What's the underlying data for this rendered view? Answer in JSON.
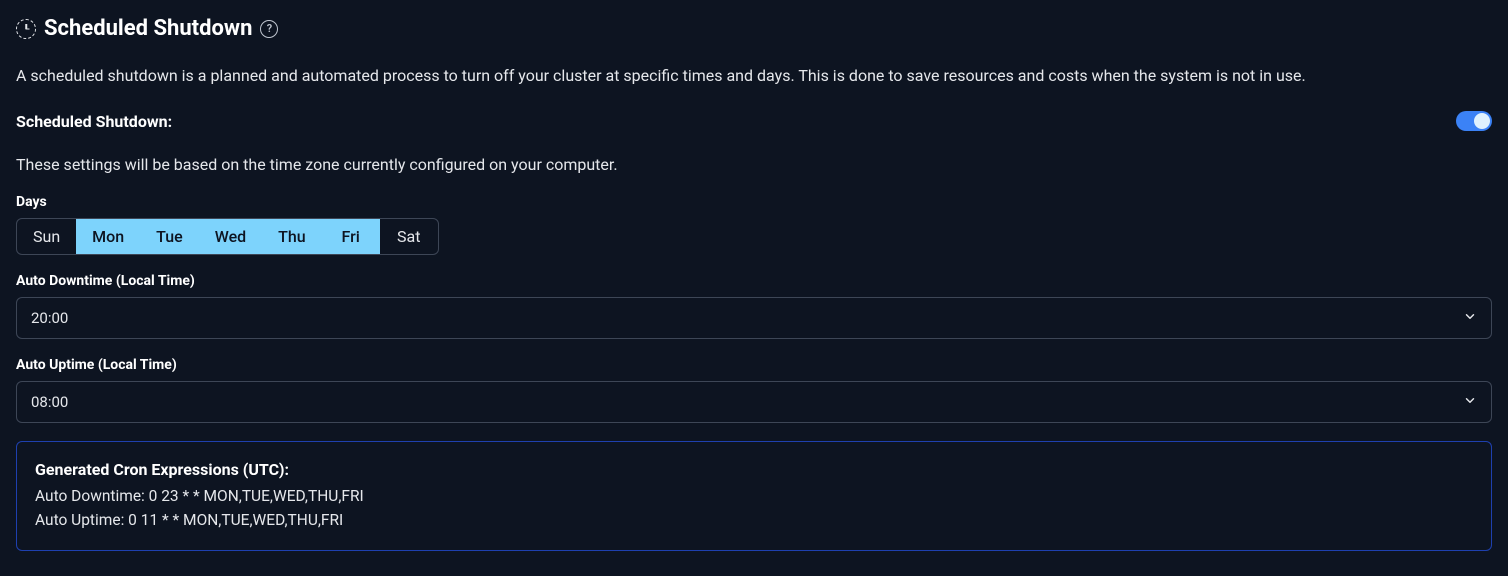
{
  "header": {
    "title": "Scheduled Shutdown",
    "help_symbol": "?"
  },
  "description": "A scheduled shutdown is a planned and automated process to turn off your cluster at specific times and days. This is done to save resources and costs when the system is not in use.",
  "toggle": {
    "label": "Scheduled Shutdown:",
    "enabled": true
  },
  "timezone_note": "These settings will be based on the time zone currently configured on your computer.",
  "days": {
    "label": "Days",
    "items": [
      {
        "label": "Sun",
        "active": false
      },
      {
        "label": "Mon",
        "active": true
      },
      {
        "label": "Tue",
        "active": true
      },
      {
        "label": "Wed",
        "active": true
      },
      {
        "label": "Thu",
        "active": true
      },
      {
        "label": "Fri",
        "active": true
      },
      {
        "label": "Sat",
        "active": false
      }
    ]
  },
  "auto_downtime": {
    "label": "Auto Downtime (Local Time)",
    "value": "20:00"
  },
  "auto_uptime": {
    "label": "Auto Uptime (Local Time)",
    "value": "08:00"
  },
  "cron": {
    "title": "Generated Cron Expressions (UTC):",
    "lines": [
      "Auto Downtime: 0 23 * * MON,TUE,WED,THU,FRI",
      "Auto Uptime: 0 11 * * MON,TUE,WED,THU,FRI"
    ]
  }
}
